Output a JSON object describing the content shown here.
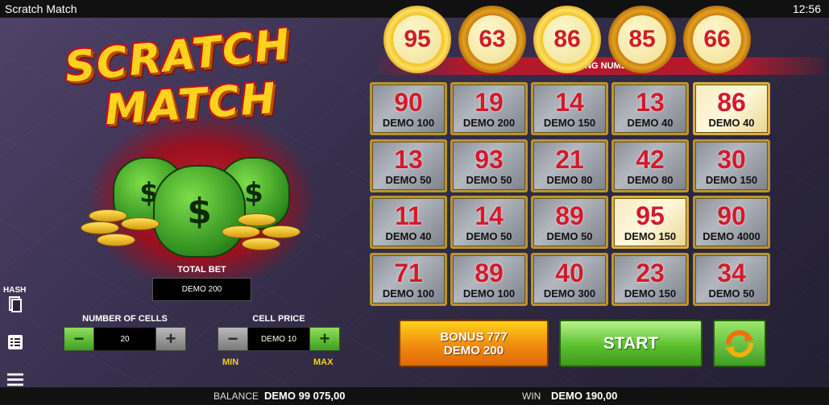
{
  "app": {
    "title": "Scratch Match",
    "clock": "12:56"
  },
  "logo": {
    "line1": "SCRATCH",
    "line2": "MATCH"
  },
  "controls": {
    "total_bet_label": "TOTAL BET",
    "total_bet_value": "DEMO 200",
    "cells_label": "NUMBER OF CELLS",
    "cells_value": "20",
    "price_label": "CELL PRICE",
    "price_value": "DEMO 10",
    "min_label": "MIN",
    "max_label": "MAX",
    "minus": "−",
    "plus": "+"
  },
  "sidebar": {
    "hash_label": "HASH"
  },
  "winning": {
    "label": "WINNING NUMBERS",
    "numbers": [
      "95",
      "63",
      "86",
      "85",
      "66"
    ]
  },
  "grid": [
    [
      {
        "num": "90",
        "prize": "DEMO 100",
        "hit": false
      },
      {
        "num": "19",
        "prize": "DEMO 200",
        "hit": false
      },
      {
        "num": "14",
        "prize": "DEMO 150",
        "hit": false
      },
      {
        "num": "13",
        "prize": "DEMO 40",
        "hit": false
      },
      {
        "num": "86",
        "prize": "DEMO 40",
        "hit": true
      }
    ],
    [
      {
        "num": "13",
        "prize": "DEMO 50",
        "hit": false
      },
      {
        "num": "93",
        "prize": "DEMO 50",
        "hit": false
      },
      {
        "num": "21",
        "prize": "DEMO 80",
        "hit": false
      },
      {
        "num": "42",
        "prize": "DEMO 80",
        "hit": false
      },
      {
        "num": "30",
        "prize": "DEMO 150",
        "hit": false
      }
    ],
    [
      {
        "num": "11",
        "prize": "DEMO 40",
        "hit": false
      },
      {
        "num": "14",
        "prize": "DEMO 50",
        "hit": false
      },
      {
        "num": "89",
        "prize": "DEMO 50",
        "hit": false
      },
      {
        "num": "95",
        "prize": "DEMO 150",
        "hit": true
      },
      {
        "num": "90",
        "prize": "DEMO 4000",
        "hit": false
      }
    ],
    [
      {
        "num": "71",
        "prize": "DEMO 100",
        "hit": false
      },
      {
        "num": "89",
        "prize": "DEMO 100",
        "hit": false
      },
      {
        "num": "40",
        "prize": "DEMO 300",
        "hit": false
      },
      {
        "num": "23",
        "prize": "DEMO 150",
        "hit": false
      },
      {
        "num": "34",
        "prize": "DEMO 50",
        "hit": false
      }
    ]
  ],
  "buttons": {
    "bonus_line1": "BONUS 777",
    "bonus_line2": "DEMO 200",
    "start": "START"
  },
  "footer": {
    "balance_label": "BALANCE",
    "balance_value": "DEMO 99 075,00",
    "win_label": "WIN",
    "win_value": "DEMO 190,00"
  },
  "colors": {
    "accent_red": "#d21a2a",
    "gold": "#f2d21a",
    "start_green": "#5cc030",
    "bonus_orange": "#f08a10"
  }
}
